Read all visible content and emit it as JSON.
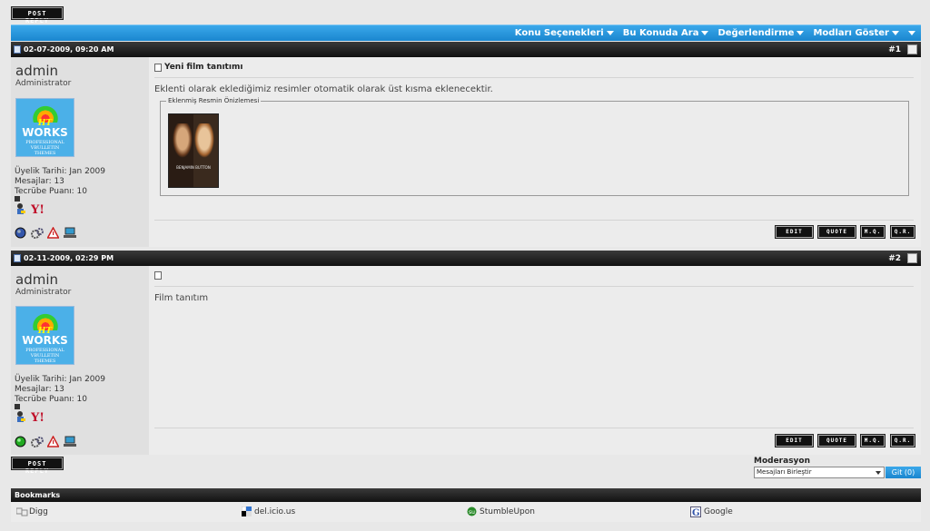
{
  "toolbar": {
    "post_reply_label": "POST REPLY"
  },
  "thread_tools": {
    "items": [
      "Konu Seçenekleri",
      "Bu Konuda Ara",
      "Değerlendirme",
      "Modları Göster"
    ]
  },
  "posts": [
    {
      "date": "02-07-2009, 09:20 AM",
      "number": "#1",
      "username": "admin",
      "role": "Administrator",
      "avatar": {
        "line1": "HT",
        "line2": "WORKS",
        "line3": "PROFESSIONAL",
        "line4": "VBULLETIN",
        "line5": "THEMES"
      },
      "join_date": "Üyelik Tarihi: Jan 2009",
      "messages": "Mesajlar: 13",
      "rep_points": "Tecrübe Puanı: 10",
      "title": "Yeni film tanıtımı",
      "body": "Eklenti olarak eklediğimiz resimler otomatik olarak üst kısma eklenecektir.",
      "attachment_legend": "Eklenmiş Resmin Önizlemesi",
      "movie_title": "BENJAMIN BUTTON",
      "online_status": "offline"
    },
    {
      "date": "02-11-2009, 02:29 PM",
      "number": "#2",
      "username": "admin",
      "role": "Administrator",
      "avatar": {
        "line1": "HT",
        "line2": "WORKS",
        "line3": "PROFESSIONAL",
        "line4": "VBULLETIN",
        "line5": "THEMES"
      },
      "join_date": "Üyelik Tarihi: Jan 2009",
      "messages": "Mesajlar: 13",
      "rep_points": "Tecrübe Puanı: 10",
      "title": "",
      "body": "Film tanıtım",
      "online_status": "online"
    }
  ],
  "post_actions": {
    "edit": "EDIT",
    "quote": "QUOTE",
    "mq": "M.Q.",
    "qr": "Q.R."
  },
  "moderation": {
    "label": "Moderasyon",
    "selected": "Mesajları Birleştir",
    "go": "Git (0)"
  },
  "bookmarks": {
    "title": "Bookmarks",
    "items": [
      "Digg",
      "del.icio.us",
      "StumbleUpon",
      "Google"
    ]
  },
  "colors": {
    "accent_blue": "#1a86cf",
    "dark_bar": "#111111",
    "online": "#22aa22",
    "offline": "#3355aa"
  }
}
